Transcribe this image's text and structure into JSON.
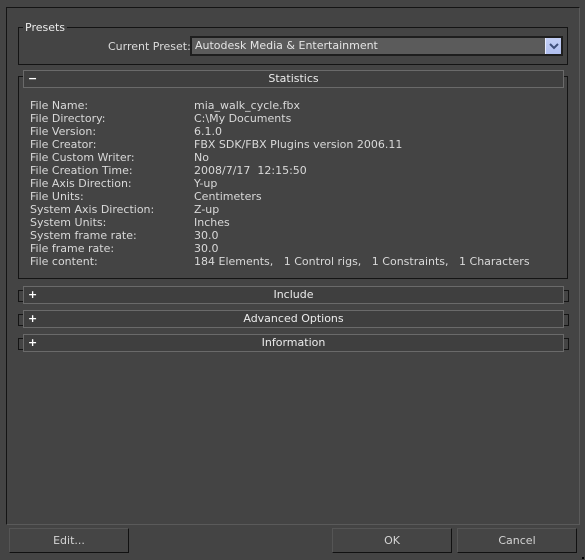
{
  "presets": {
    "group_title": "Presets",
    "current_preset_label": "Current Preset:",
    "current_preset_value": "Autodesk Media & Entertainment"
  },
  "rollouts": {
    "statistics": {
      "toggle": "−",
      "title": "Statistics",
      "expanded": true
    },
    "include": {
      "toggle": "+",
      "title": "Include",
      "expanded": false
    },
    "advanced_options": {
      "toggle": "+",
      "title": "Advanced Options",
      "expanded": false
    },
    "information": {
      "toggle": "+",
      "title": "Information",
      "expanded": false
    }
  },
  "statistics": [
    {
      "key": "File Name:",
      "value": "mia_walk_cycle.fbx"
    },
    {
      "key": "File Directory:",
      "value": "C:\\My Documents"
    },
    {
      "key": "File Version:",
      "value": "6.1.0"
    },
    {
      "key": "File Creator:",
      "value": "FBX SDK/FBX Plugins version 2006.11"
    },
    {
      "key": "File Custom Writer:",
      "value": "No"
    },
    {
      "key": "File Creation Time:",
      "value": "2008/7/17  12:15:50"
    },
    {
      "key": "File Axis Direction:",
      "value": "Y-up"
    },
    {
      "key": "File Units:",
      "value": "Centimeters"
    },
    {
      "key": "System Axis Direction:",
      "value": "Z-up"
    },
    {
      "key": "System Units:",
      "value": "Inches"
    },
    {
      "key": "System frame rate:",
      "value": "30.0"
    },
    {
      "key": "File frame rate:",
      "value": "30.0"
    },
    {
      "key": "File content:",
      "value": "184 Elements,   1 Control rigs,   1 Constraints,   1 Characters"
    }
  ],
  "buttons": {
    "edit": "Edit...",
    "ok": "OK",
    "cancel": "Cancel"
  }
}
